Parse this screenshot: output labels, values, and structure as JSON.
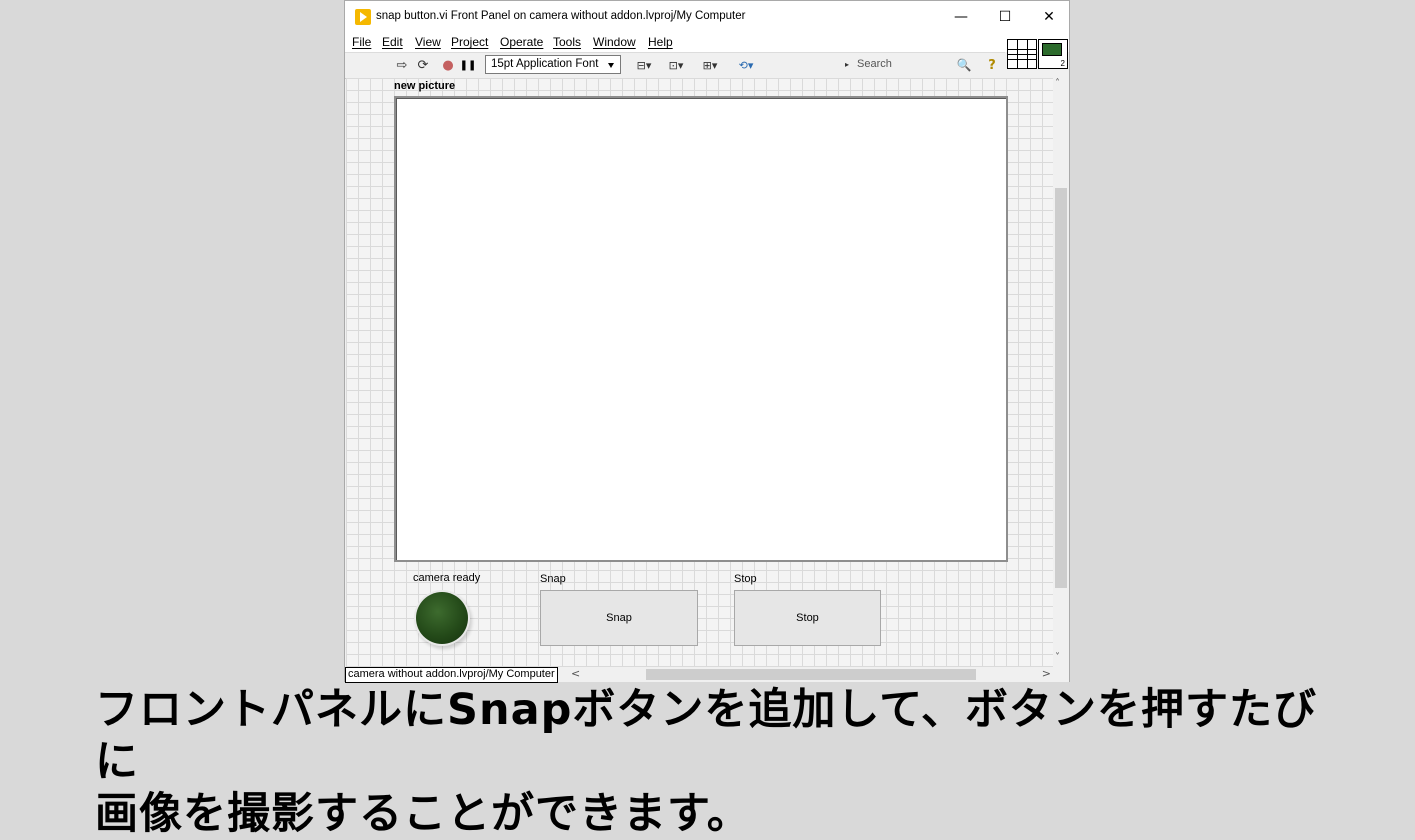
{
  "window": {
    "title": "snap button.vi Front Panel on camera without addon.lvproj/My Computer",
    "minimize_glyph": "—",
    "maximize_glyph": "☐",
    "close_glyph": "✕"
  },
  "menu": {
    "items": [
      {
        "label": "File"
      },
      {
        "label": "Edit"
      },
      {
        "label": "View"
      },
      {
        "label": "Project"
      },
      {
        "label": "Operate"
      },
      {
        "label": "Tools"
      },
      {
        "label": "Window"
      },
      {
        "label": "Help"
      }
    ]
  },
  "toolbar": {
    "font_value": "15pt Application Font",
    "search_placeholder": "Search",
    "icons": {
      "run": "⇨",
      "run_continuously": "⟳",
      "abort": "●",
      "pause": "❚❚",
      "align": "⊟▾",
      "distribute": "⊡▾",
      "resize": "⊞▾",
      "reorder": "⟲▾",
      "search": "🔍",
      "help": "?"
    }
  },
  "connector": {
    "terminal_count": "2"
  },
  "panel": {
    "picture_label": "new picture",
    "indicator_label": "camera ready",
    "snap_label": "Snap",
    "snap_text": "Snap",
    "stop_label": "Stop",
    "stop_text": "Stop"
  },
  "status": {
    "context": "camera without addon.lvproj/My Computer",
    "scroll_left": "<",
    "scroll_right": ">",
    "scroll_up": "˄",
    "scroll_down": "˅"
  },
  "caption": {
    "line1": "フロントパネルにSnapボタンを追加して、ボタンを押すたびに",
    "line2": "画像を撮影することができます。"
  },
  "colors": {
    "led_off": "#244a19",
    "app_icon": "#f5b800"
  }
}
